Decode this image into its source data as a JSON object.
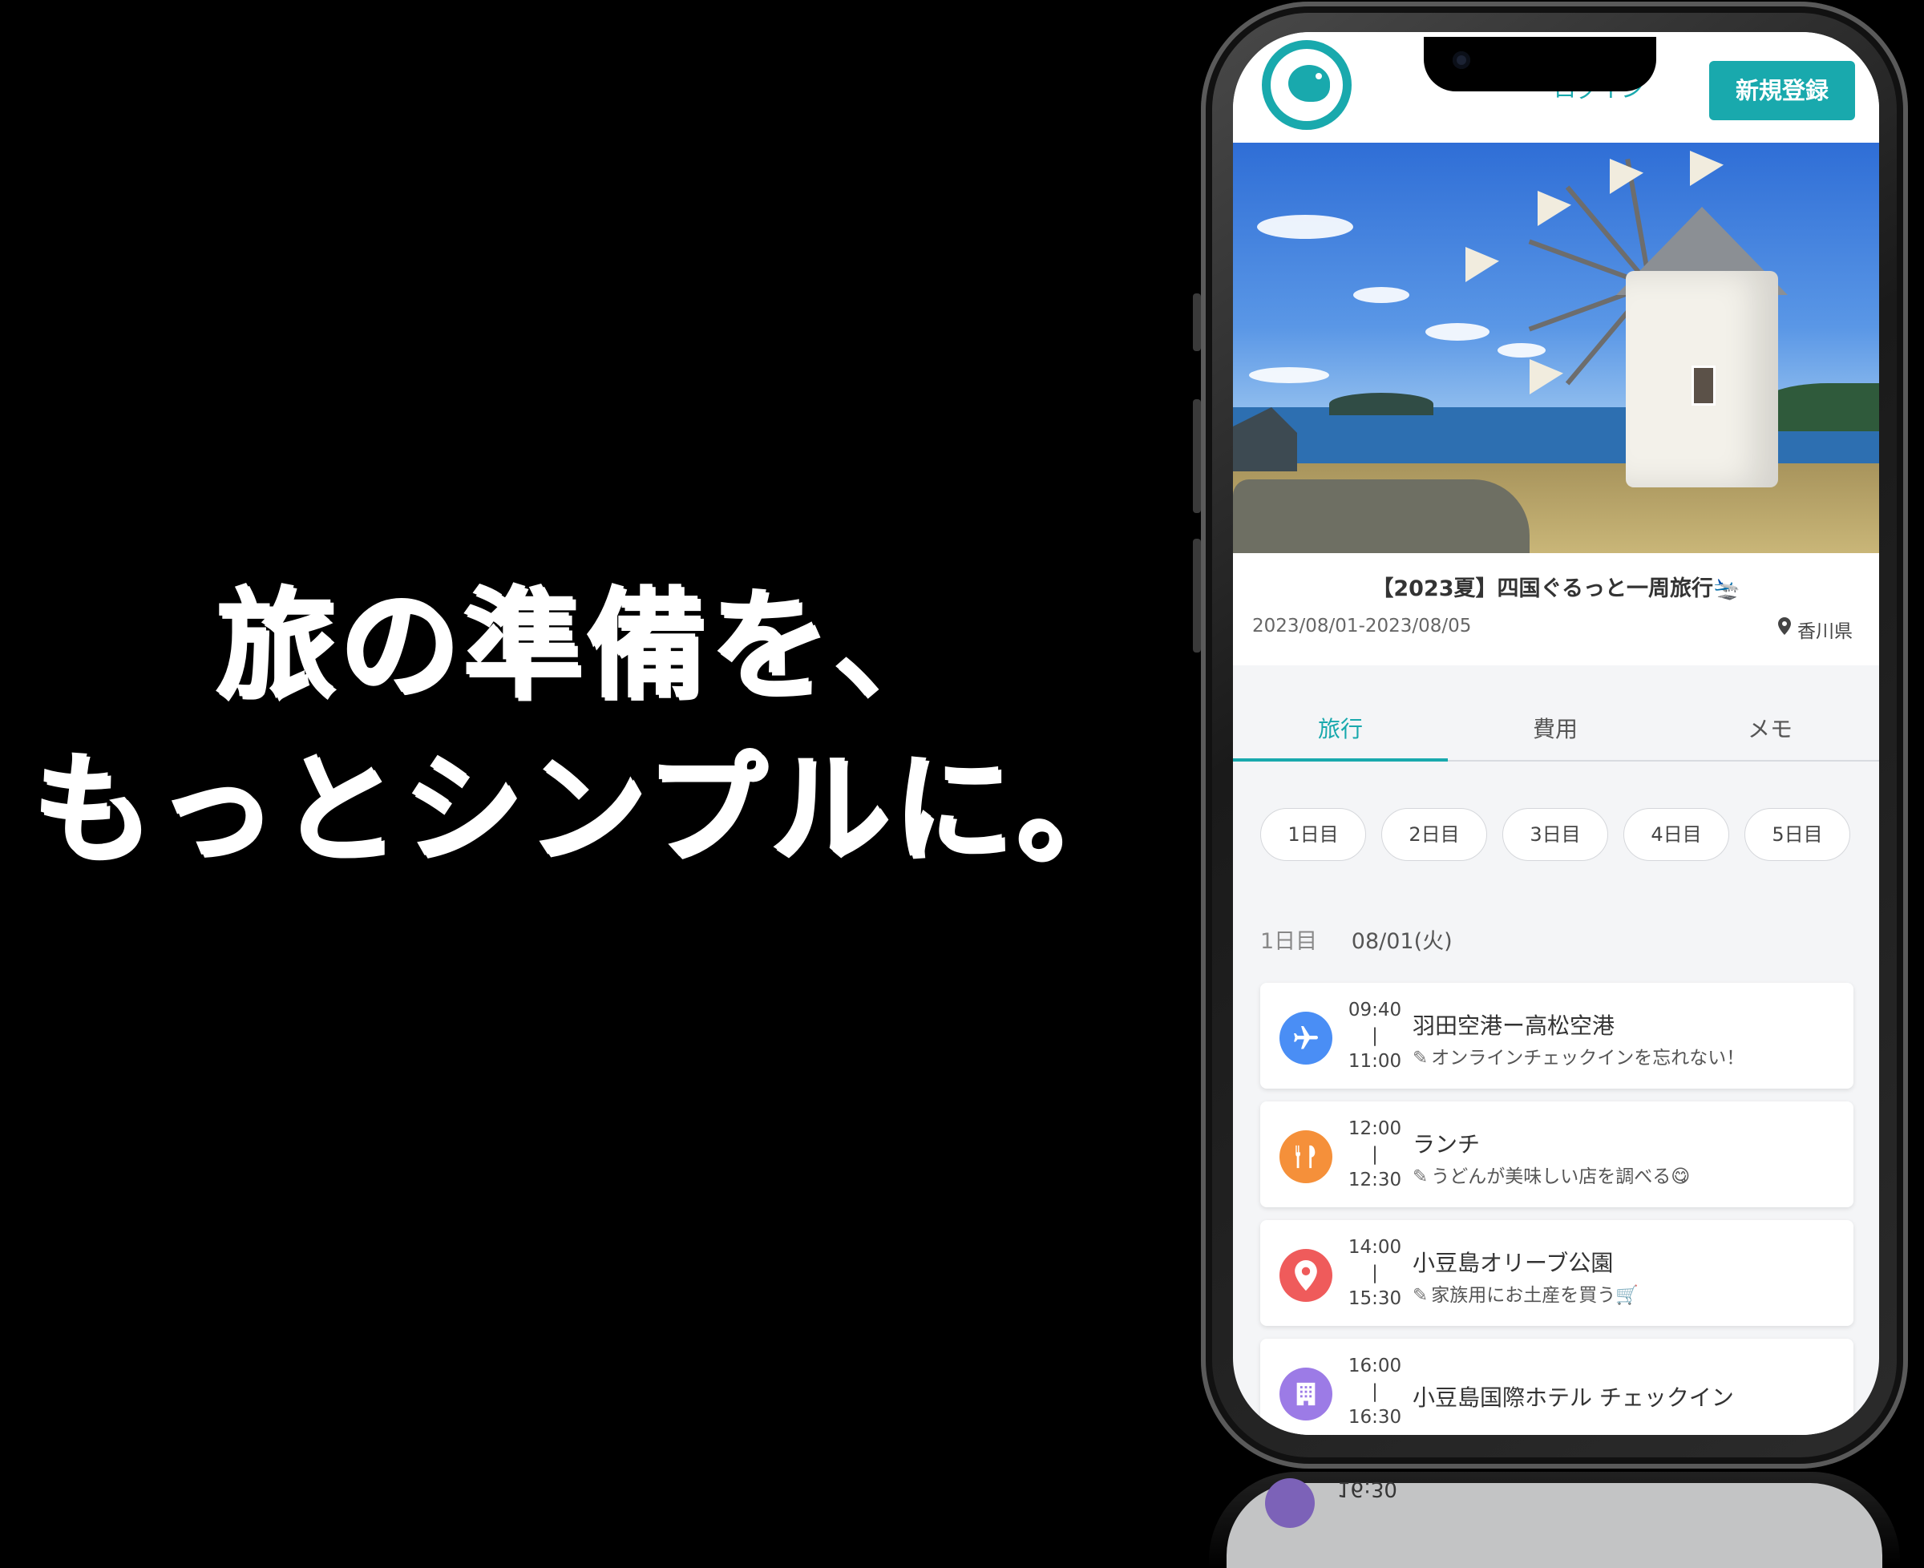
{
  "headline": {
    "line1": "旅の準備を、",
    "line2": "もっとシンプルに。"
  },
  "header": {
    "login_label": "ログイン",
    "signup_label": "新規登録"
  },
  "trip": {
    "title": "【2023夏】四国ぐるっと一周旅行🛬",
    "dates": "2023/08/01-2023/08/05",
    "place": "香川県"
  },
  "tabs": [
    {
      "label": "旅行",
      "active": true
    },
    {
      "label": "費用",
      "active": false
    },
    {
      "label": "メモ",
      "active": false
    }
  ],
  "days": [
    "1日目",
    "2日目",
    "3日目",
    "4日目",
    "5日目"
  ],
  "day_header": {
    "label": "1日目",
    "date": "08/01(火)"
  },
  "schedule": [
    {
      "icon": "airplane-icon",
      "color": "#4a8ef5",
      "start": "09:40",
      "sep": "|",
      "end": "11:00",
      "title": "羽田空港ー高松空港",
      "memo": "オンラインチェックインを忘れない！"
    },
    {
      "icon": "restaurant-icon",
      "color": "#f5903a",
      "start": "12:00",
      "sep": "|",
      "end": "12:30",
      "title": "ランチ",
      "memo": "うどんが美味しい店を調べる😋"
    },
    {
      "icon": "location-pin-icon",
      "color": "#ef5b5b",
      "start": "14:00",
      "sep": "|",
      "end": "15:30",
      "title": "小豆島オリーブ公園",
      "memo": "家族用にお土産を買う🛒"
    },
    {
      "icon": "hotel-icon",
      "color": "#9c7be6",
      "start": "16:00",
      "sep": "|",
      "end": "16:30",
      "title": "小豆島国際ホテル チェックイン",
      "memo": ""
    }
  ],
  "reflection": {
    "time": "16:30"
  },
  "colors": {
    "accent": "#19a9ad",
    "background": "#000000",
    "screen_bg": "#f4f5f7"
  }
}
